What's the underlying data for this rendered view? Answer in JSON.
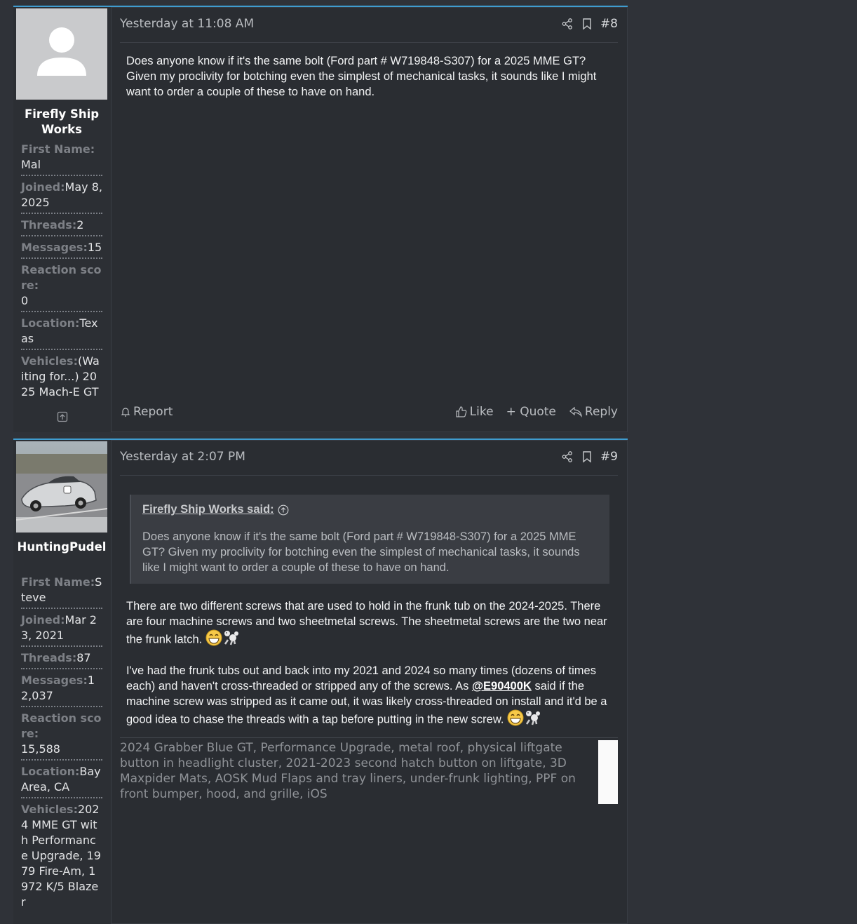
{
  "posts": [
    {
      "author": "Firefly Ship Works",
      "date": "Yesterday at 11:08 AM",
      "number": "#8",
      "extras": [
        {
          "label": "First Name:",
          "value": "Mal"
        },
        {
          "label": "Joined:",
          "value": "May 8, 2025"
        },
        {
          "label": "Threads:",
          "value": "2"
        },
        {
          "label": "Messages:",
          "value": "15"
        },
        {
          "label": "Reaction score:",
          "value": "0"
        },
        {
          "label": "Location:",
          "value": "Texas"
        },
        {
          "label": "Vehicles:",
          "value": "(Waiting for...) 2025 Mach-E GT"
        }
      ],
      "body": "Does anyone know if it's the same bolt (Ford part # W719848-S307) for a 2025 MME GT? Given my proclivity for botching even the simplest of mechanical tasks, it sounds like I might want to order a couple of these to have on hand.",
      "report_label": "Report",
      "like_label": "Like",
      "quote_label": "+ Quote",
      "reply_label": "Reply"
    },
    {
      "author": "HuntingPudel",
      "date": "Yesterday at 2:07 PM",
      "number": "#9",
      "extras": [
        {
          "label": "First Name:",
          "value": "Steve"
        },
        {
          "label": "Joined:",
          "value": "Mar 23, 2021"
        },
        {
          "label": "Threads:",
          "value": "87"
        },
        {
          "label": "Messages:",
          "value": "12,037"
        },
        {
          "label": "Reaction score:",
          "value": "15,588"
        },
        {
          "label": "Location:",
          "value": "Bay Area, CA"
        },
        {
          "label": "Vehicles:",
          "value": "2024 MME GT with Performance Upgrade, 1979 Fire-Am, 1972 K/5 Blazer"
        }
      ],
      "quote_author": "Firefly Ship Works said:",
      "quote_text": "Does anyone know if it's the same bolt (Ford part # W719848-S307) for a 2025 MME GT? Given my proclivity for botching even the simplest of mechanical tasks, it sounds like I might want to order a couple of these to have on hand.",
      "para1": "There are two different screws that are used to hold in the frunk tub on the 2024-2025. There are four machine screws and two sheetmetal screws. The sheetmetal screws are the two near the frunk latch.",
      "para2_a": "I've had the frunk tubs out and back into my 2021 and 2024 so many times (dozens of times each) and haven't cross-threaded or stripped any of the screws. As",
      "mention": "@E90400K",
      "para2_b": "said if the machine screw was stripped as it came out, it was likely cross-threaded on install and it'd be a good idea to chase the threads with a tap before putting in the new screw.",
      "signature": "2024 Grabber Blue GT, Performance Upgrade, metal roof, physical liftgate button in headlight cluster, 2021-2023 second hatch button on liftgate, 3D Maxpider Mats, AOSK Mud Flaps and tray liners, under-frunk lighting, PPF on front bumper, hood, and grille, iOS"
    }
  ],
  "colors": {
    "accent": "#3f9ccf",
    "background": "#2f3238",
    "post_bg": "#2a2d32"
  },
  "icons": [
    "user-placeholder-icon",
    "share-icon",
    "bookmark-icon",
    "bell-icon",
    "thumbs-up-icon",
    "reply-icon",
    "collapse-icon",
    "arrow-up-circle-icon",
    "grin-emoji",
    "dog-emoji"
  ]
}
